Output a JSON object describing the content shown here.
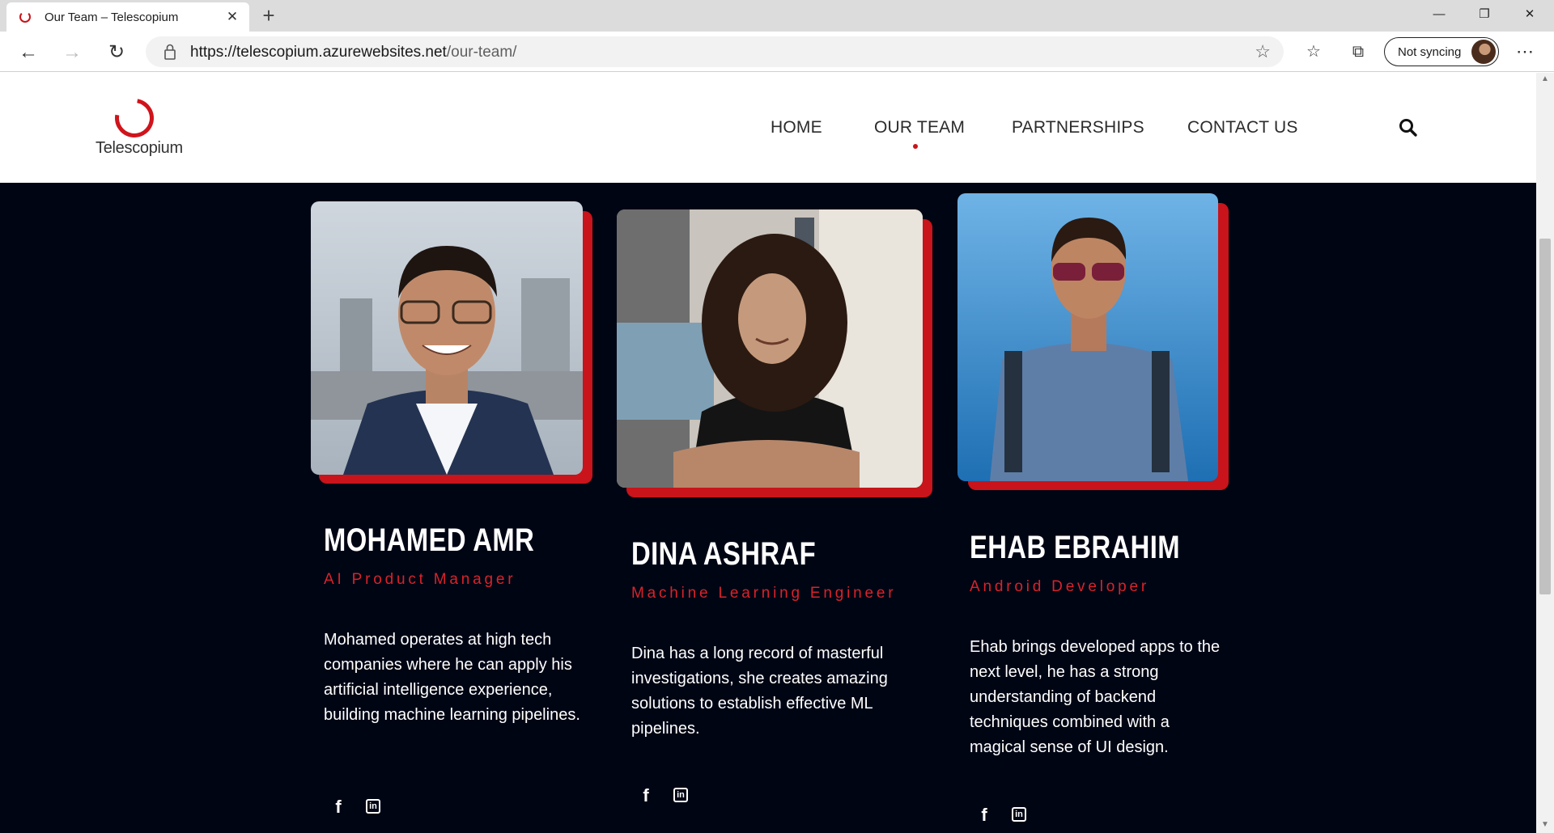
{
  "browser": {
    "tab_title": "Our Team – Telescopium",
    "url_host": "https://telescopium.azurewebsites.net",
    "url_path": "/our-team/",
    "sync_label": "Not syncing",
    "icons": [
      "back-icon",
      "forward-icon",
      "refresh-icon",
      "lock-icon",
      "favorite-star-icon",
      "favorites-icon",
      "collections-icon",
      "more-icon",
      "minimize-icon",
      "maximize-icon",
      "close-icon"
    ]
  },
  "site": {
    "logo_text": "Telescopium",
    "brand_color": "#c8141a",
    "nav": [
      {
        "label": "HOME",
        "active": false
      },
      {
        "label": "OUR TEAM",
        "active": true
      },
      {
        "label": "PARTNERSHIPS",
        "active": false
      },
      {
        "label": "CONTACT US",
        "active": false
      }
    ]
  },
  "team": [
    {
      "name": "MOHAMED AMR",
      "role": "AI Product Manager",
      "bio": "Mohamed operates at high tech companies where he can apply his artificial intelligence experience, building machine learning pipelines.",
      "social": [
        "facebook-icon",
        "linkedin-icon"
      ]
    },
    {
      "name": "DINA ASHRAF",
      "role": "Machine Learning Engineer",
      "bio": "Dina has a long record of masterful investigations, she creates amazing solutions to establish effective ML pipelines.",
      "social": [
        "facebook-icon",
        "linkedin-icon"
      ]
    },
    {
      "name": "EHAB EBRAHIM",
      "role": "Android Developer",
      "bio": "Ehab brings developed apps to the next level, he has a strong understanding of backend techniques combined with a magical sense of UI design.",
      "social": [
        "facebook-icon",
        "linkedin-icon"
      ]
    }
  ]
}
